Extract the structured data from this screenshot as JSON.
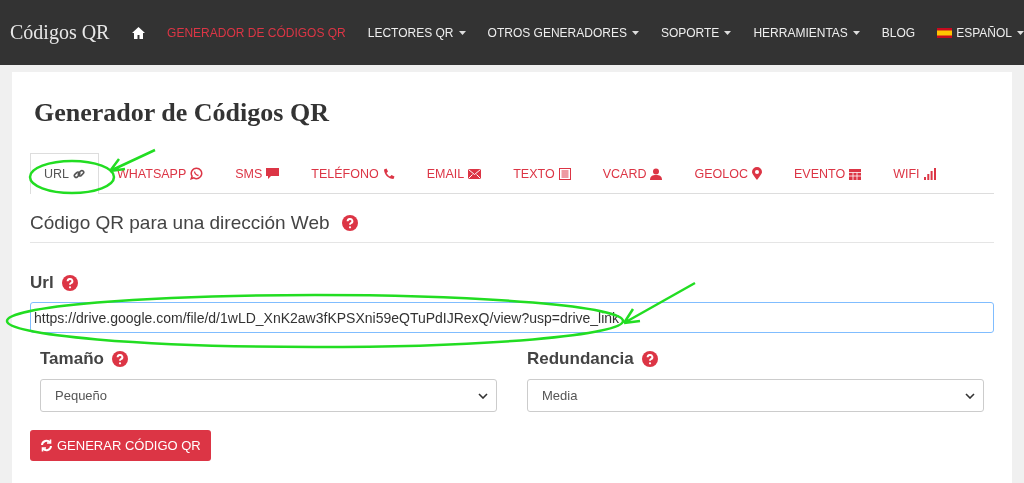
{
  "navbar": {
    "brand": "Códigos QR",
    "items": [
      {
        "kind": "home",
        "selected": false
      },
      {
        "kind": "link",
        "label": "GENERADOR DE CÓDIGOS QR",
        "selected": true
      },
      {
        "kind": "dropdown",
        "label": "LECTORES QR",
        "selected": false
      },
      {
        "kind": "dropdown",
        "label": "OTROS GENERADORES",
        "selected": false
      },
      {
        "kind": "dropdown",
        "label": "SOPORTE",
        "selected": false
      },
      {
        "kind": "dropdown",
        "label": "HERRAMIENTAS",
        "selected": false
      },
      {
        "kind": "link",
        "label": "BLOG",
        "selected": false
      },
      {
        "kind": "language",
        "label": "ESPAÑOL",
        "selected": false
      }
    ]
  },
  "page": {
    "title": "Generador de Códigos QR"
  },
  "tabs": [
    {
      "label": "URL",
      "kind": "link",
      "selected": true
    },
    {
      "label": "WHATSAPP",
      "kind": "whatsapp",
      "selected": false
    },
    {
      "label": "SMS",
      "kind": "chat",
      "selected": false
    },
    {
      "label": "TELÉFONO",
      "kind": "phone",
      "selected": false
    },
    {
      "label": "EMAIL",
      "kind": "mail",
      "selected": false
    },
    {
      "label": "TEXTO",
      "kind": "text",
      "selected": false
    },
    {
      "label": "VCARD",
      "kind": "user",
      "selected": false
    },
    {
      "label": "GEOLOC",
      "kind": "pin",
      "selected": false
    },
    {
      "label": "EVENTO",
      "kind": "calendar",
      "selected": false
    },
    {
      "label": "WIFI",
      "kind": "signal",
      "selected": false
    }
  ],
  "section": {
    "heading": "Código QR para una dirección Web"
  },
  "url_field": {
    "label": "Url",
    "value": "https://drive.google.com/file/d/1wLD_XnK2aw3fKPSXni59eQTuPdIJRexQ/view?usp=drive_link"
  },
  "size_field": {
    "label": "Tamaño",
    "value": "Pequeño"
  },
  "redundancy_field": {
    "label": "Redundancia",
    "value": "Media"
  },
  "generate_button": {
    "label": "GENERAR CÓDIGO QR"
  }
}
